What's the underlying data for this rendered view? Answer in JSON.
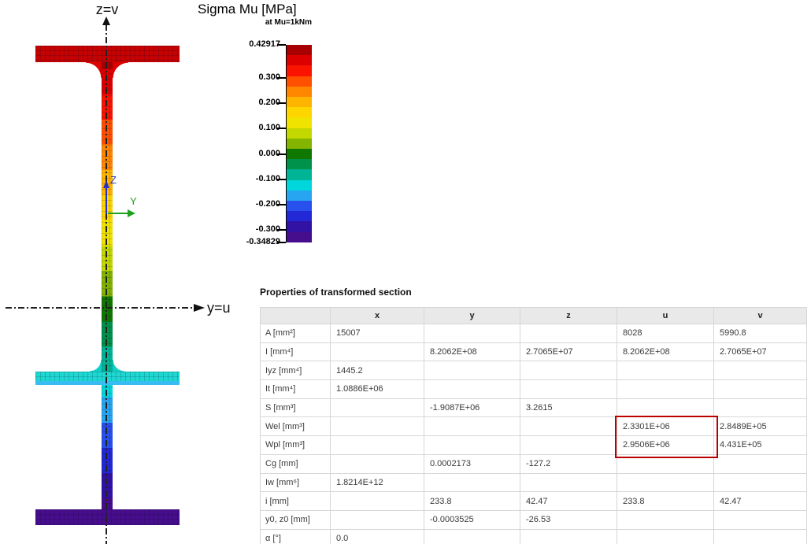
{
  "section_view": {
    "top_axis_label": "z=v",
    "horizontal_axis_label": "y=u",
    "local_axes": {
      "z": "Z",
      "y": "Y",
      "z_color": "#2233cc",
      "y_color": "#1fa01f"
    },
    "flange_colors": {
      "top": "#c50202",
      "middle": "#1ed7d0",
      "bottom": "#470e8c"
    }
  },
  "legend": {
    "title": "Sigma Mu [MPa]",
    "subtitle": "at Mu=1kNm",
    "max_label": "0.42917",
    "min_label": "-0.34829",
    "ticks": [
      {
        "label": "0.42917",
        "value": 0.42917
      },
      {
        "label": "0.300",
        "value": 0.3
      },
      {
        "label": "0.200",
        "value": 0.2
      },
      {
        "label": "0.100",
        "value": 0.1
      },
      {
        "label": "0.000",
        "value": 0.0
      },
      {
        "label": "-0.100",
        "value": -0.1
      },
      {
        "label": "-0.200",
        "value": -0.2
      },
      {
        "label": "-0.300",
        "value": -0.3
      },
      {
        "label": "-0.34829",
        "value": -0.34829
      }
    ],
    "band_colors": [
      "#a80000",
      "#dc0000",
      "#fa1400",
      "#ff5000",
      "#ff8700",
      "#ffb400",
      "#ffd500",
      "#f0e300",
      "#c3d800",
      "#82b400",
      "#107800",
      "#00914b",
      "#00b496",
      "#00d7dc",
      "#28a5f0",
      "#2850ed",
      "#2328d7",
      "#3211a5",
      "#460e8c"
    ]
  },
  "table": {
    "title": "Properties of transformed section",
    "columns": [
      "",
      "x",
      "y",
      "z",
      "u",
      "v"
    ],
    "rows": [
      {
        "label": "A [mm²]",
        "x": "15007",
        "y": "",
        "z": "",
        "u": "8028",
        "v": "5990.8"
      },
      {
        "label": "I [mm⁴]",
        "x": "",
        "y": "8.2062E+08",
        "z": "2.7065E+07",
        "u": "8.2062E+08",
        "v": "2.7065E+07"
      },
      {
        "label": "Iyz [mm⁴]",
        "x": "1445.2",
        "y": "",
        "z": "",
        "u": "",
        "v": ""
      },
      {
        "label": "It [mm⁴]",
        "x": "1.0886E+06",
        "y": "",
        "z": "",
        "u": "",
        "v": ""
      },
      {
        "label": "S [mm³]",
        "x": "",
        "y": "-1.9087E+06",
        "z": "3.2615",
        "u": "",
        "v": ""
      },
      {
        "label": "Wel [mm³]",
        "x": "",
        "y": "",
        "z": "",
        "u": "2.3301E+06",
        "v": "2.8489E+05"
      },
      {
        "label": "Wpl [mm³]",
        "x": "",
        "y": "",
        "z": "",
        "u": "2.9506E+06",
        "v": "4.431E+05"
      },
      {
        "label": "Cg [mm]",
        "x": "",
        "y": "0.0002173",
        "z": "-127.2",
        "u": "",
        "v": ""
      },
      {
        "label": "Iw [mm⁶]",
        "x": "1.8214E+12",
        "y": "",
        "z": "",
        "u": "",
        "v": ""
      },
      {
        "label": "i [mm]",
        "x": "",
        "y": "233.8",
        "z": "42.47",
        "u": "233.8",
        "v": "42.47"
      },
      {
        "label": "y0, z0 [mm]",
        "x": "",
        "y": "-0.0003525",
        "z": "-26.53",
        "u": "",
        "v": ""
      },
      {
        "label": "α [°]",
        "x": "0.0",
        "y": "",
        "z": "",
        "u": "",
        "v": ""
      }
    ],
    "highlight": {
      "column": "u",
      "rows": [
        "Wel [mm³]",
        "Wpl [mm³]"
      ],
      "color": "#bb0000"
    }
  }
}
